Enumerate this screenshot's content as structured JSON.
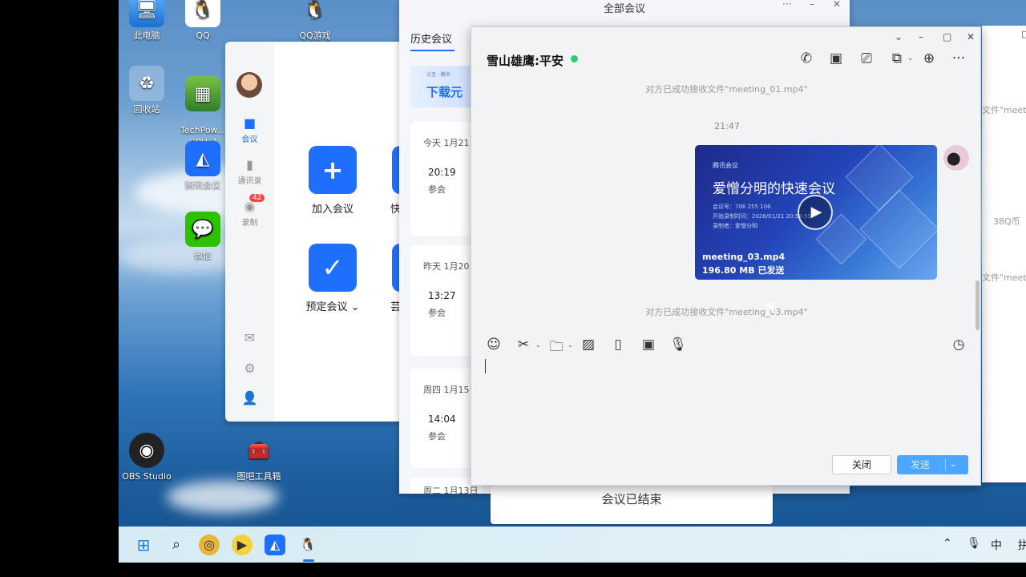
{
  "desktop": {
    "icons": [
      {
        "name": "此电脑"
      },
      {
        "name": "QQ"
      },
      {
        "name": "QQ游戏"
      },
      {
        "name": "回收站"
      },
      {
        "name": "TechPow...\nGPU-Z"
      },
      {
        "name": "腾讯会议"
      },
      {
        "name": "微信"
      },
      {
        "name": "OBS Studio"
      },
      {
        "name": "图吧工具箱"
      }
    ]
  },
  "tencent_meeting": {
    "sidebar": {
      "meeting": "会议",
      "contacts": "通讯录",
      "recording": "录制",
      "recording_badge": "42"
    },
    "actions": {
      "join": "加入会议",
      "schedule": "预定会议 ⌄",
      "quick_partial": "快",
      "other_partial": "芸"
    }
  },
  "all_meetings": {
    "title": "全部会议",
    "tab_history": "历史会议",
    "banner_text": "下载元",
    "banner_brand": "元宝 · 腾讯",
    "cards": [
      {
        "date": "今天 1月21",
        "time": "20:19",
        "status": "参会"
      },
      {
        "date": "昨天 1月20",
        "time": "13:27",
        "status": "参会"
      },
      {
        "date": "周四 1月15",
        "time": "14:04",
        "status": "参会"
      },
      {
        "date": "周二 1月13日",
        "time": "",
        "status": ""
      }
    ],
    "ended_text": "会议已结束"
  },
  "right_window": {
    "texts": [
      "文件\"meetin",
      "38Q币",
      "文件\"meetin"
    ]
  },
  "chat": {
    "contact": "雪山雄鹰:平安",
    "system_top": "对方已成功接收文件\"meeting_01.mp4\"",
    "time": "21:47",
    "video": {
      "brand": "腾讯会议",
      "title": "爱憎分明的快速会议",
      "meeting_id": "会议号：706 255 106",
      "start_time": "开始录制时间：2026/01/21 20:59:55",
      "recorder": "录制者：爱憎分明",
      "file_name": "meeting_03.mp4",
      "size_status": "196.80 MB 已发送"
    },
    "system_bottom": "对方已成功接收文件\"meeting_03.mp4\"",
    "buttons": {
      "close": "关闭",
      "send": "发送"
    }
  },
  "taskbar": {
    "tray_lang": "中",
    "tray_extra": "拼"
  },
  "colors": {
    "accent": "#1f6fff",
    "online": "#2ecc71",
    "send_button": "#4aa6ff"
  }
}
